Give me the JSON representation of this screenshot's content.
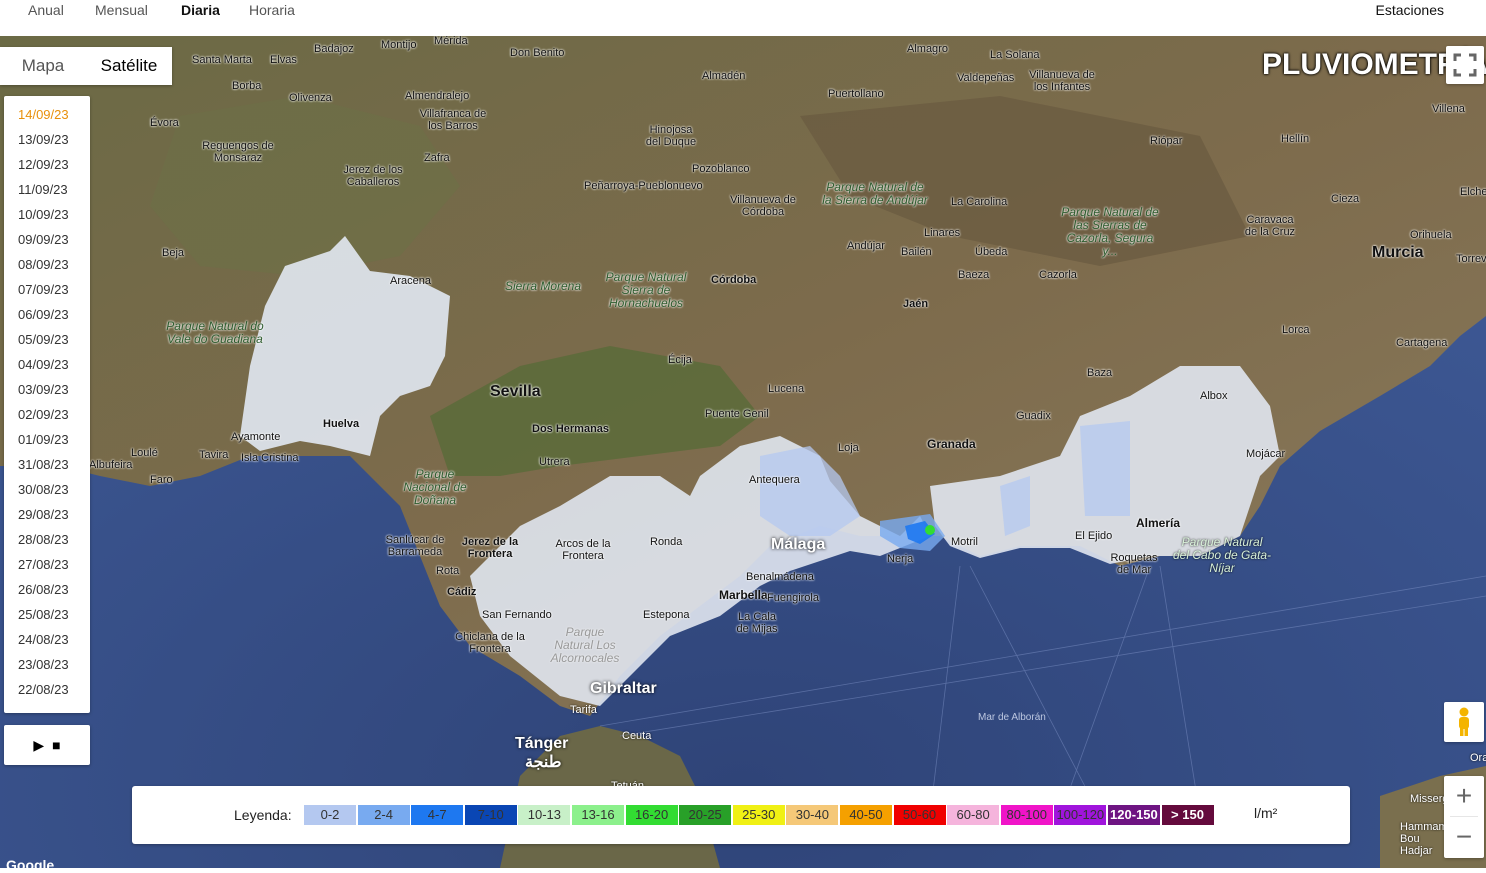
{
  "nav": {
    "tabs": [
      {
        "label": "Anual"
      },
      {
        "label": "Mensual"
      },
      {
        "label": "Diaria"
      },
      {
        "label": "Horaria"
      }
    ],
    "stations": "Estaciones"
  },
  "map_type": {
    "map": "Mapa",
    "satellite": "Satélite"
  },
  "title": "PLUVIOMETRÍA",
  "dates": [
    "14/09/23",
    "13/09/23",
    "12/09/23",
    "11/09/23",
    "10/09/23",
    "09/09/23",
    "08/09/23",
    "07/09/23",
    "06/09/23",
    "05/09/23",
    "04/09/23",
    "03/09/23",
    "02/09/23",
    "01/09/23",
    "31/08/23",
    "30/08/23",
    "29/08/23",
    "28/08/23",
    "27/08/23",
    "26/08/23",
    "25/08/23",
    "24/08/23",
    "23/08/23",
    "22/08/23"
  ],
  "selected_date": "14/09/23",
  "controls": {
    "play": "▶",
    "stop": "■"
  },
  "legend": {
    "label": "Leyenda:",
    "unit": "l/m²",
    "ranges": [
      {
        "label": "0-2",
        "color": "#b4c8f0"
      },
      {
        "label": "2-4",
        "color": "#78aaf0"
      },
      {
        "label": "4-7",
        "color": "#1e78f0"
      },
      {
        "label": "7-10",
        "color": "#0a46b4"
      },
      {
        "label": "10-13",
        "color": "#c8f0c8"
      },
      {
        "label": "13-16",
        "color": "#8cf08c"
      },
      {
        "label": "16-20",
        "color": "#32dc32"
      },
      {
        "label": "20-25",
        "color": "#28a028"
      },
      {
        "label": "25-30",
        "color": "#f0f014"
      },
      {
        "label": "30-40",
        "color": "#f5c878"
      },
      {
        "label": "40-50",
        "color": "#f5a000"
      },
      {
        "label": "50-60",
        "color": "#f00000"
      },
      {
        "label": "60-80",
        "color": "#f5b4dc"
      },
      {
        "label": "80-100",
        "color": "#f014c8"
      },
      {
        "label": "100-120",
        "color": "#a014dc"
      },
      {
        "label": "120-150",
        "color": "#6e1482"
      },
      {
        "label": "> 150",
        "color": "#640a3c"
      }
    ]
  },
  "places": [
    {
      "name": "Badajoz"
    },
    {
      "name": "Montijo"
    },
    {
      "name": "Mérida"
    },
    {
      "name": "Don Benito"
    },
    {
      "name": "Almagro"
    },
    {
      "name": "La Solana"
    },
    {
      "name": "Valdepeñas"
    },
    {
      "name": "Villanueva de los Infantes"
    },
    {
      "name": "Santa Marta"
    },
    {
      "name": "Elvas"
    },
    {
      "name": "Almendralejo"
    },
    {
      "name": "Almadén"
    },
    {
      "name": "Puertollano"
    },
    {
      "name": "Borba"
    },
    {
      "name": "Olivenza"
    },
    {
      "name": "Villafranca de los Barros"
    },
    {
      "name": "Évora"
    },
    {
      "name": "Hinojosa del Duque"
    },
    {
      "name": "Villena"
    },
    {
      "name": "Hellín"
    },
    {
      "name": "Riópar"
    },
    {
      "name": "Reguengos de Monsaraz"
    },
    {
      "name": "Zafra"
    },
    {
      "name": "Pozoblanco"
    },
    {
      "name": "Jerez de los Caballeros"
    },
    {
      "name": "Peñarroya-Pueblonuevo"
    },
    {
      "name": "Parque Natural de la Sierra de Andújar"
    },
    {
      "name": "Villanueva de Córdoba"
    },
    {
      "name": "La Carolina"
    },
    {
      "name": "Elche"
    },
    {
      "name": "Cieza"
    },
    {
      "name": "Parque Natural de las Sierras de Cazorla, Segura y..."
    },
    {
      "name": "Caravaca de la Cruz"
    },
    {
      "name": "Orihuela"
    },
    {
      "name": "Linares"
    },
    {
      "name": "Andújar"
    },
    {
      "name": "Bailén"
    },
    {
      "name": "Úbeda"
    },
    {
      "name": "Beja"
    },
    {
      "name": "Murcia"
    },
    {
      "name": "Torrevieja"
    },
    {
      "name": "Aracena"
    },
    {
      "name": "Baeza"
    },
    {
      "name": "Cazorla"
    },
    {
      "name": "Córdoba"
    },
    {
      "name": "Parque Natural Sierra de Hornachuelos"
    },
    {
      "name": "Sierra Morena"
    },
    {
      "name": "Jaén"
    },
    {
      "name": "Parque Natural do Vale do Guadiana"
    },
    {
      "name": "Lorca"
    },
    {
      "name": "Cartagena"
    },
    {
      "name": "Écija"
    },
    {
      "name": "Baza"
    },
    {
      "name": "Sevilla"
    },
    {
      "name": "Albox"
    },
    {
      "name": "Lucena"
    },
    {
      "name": "Puente Genil"
    },
    {
      "name": "Guadix"
    },
    {
      "name": "Ayamonte"
    },
    {
      "name": "Huelva"
    },
    {
      "name": "Dos Hermanas"
    },
    {
      "name": "Loja"
    },
    {
      "name": "Granada"
    },
    {
      "name": "Mojácar"
    },
    {
      "name": "Loulé"
    },
    {
      "name": "Tavira"
    },
    {
      "name": "Isla Cristina"
    },
    {
      "name": "Albufeira"
    },
    {
      "name": "Utrera"
    },
    {
      "name": "Faro"
    },
    {
      "name": "Antequera"
    },
    {
      "name": "Parque Nacional de Doñana"
    },
    {
      "name": "Arcos de la Frontera"
    },
    {
      "name": "Almería"
    },
    {
      "name": "El Ejido"
    },
    {
      "name": "Sanlúcar de Barrameda"
    },
    {
      "name": "Jerez de la Frontera"
    },
    {
      "name": "Ronda"
    },
    {
      "name": "Málaga"
    },
    {
      "name": "Motril"
    },
    {
      "name": "Parque Natural del Cabo de Gata-Níjar"
    },
    {
      "name": "Nerja"
    },
    {
      "name": "Roquetas de Mar"
    },
    {
      "name": "Rota"
    },
    {
      "name": "Benalmádena"
    },
    {
      "name": "Cádiz"
    },
    {
      "name": "Marbella"
    },
    {
      "name": "Fuengirola"
    },
    {
      "name": "San Fernando"
    },
    {
      "name": "Estepona"
    },
    {
      "name": "La Cala de Mijas"
    },
    {
      "name": "Chiclana de la Frontera"
    },
    {
      "name": "Parque Natural Los Alcornocales"
    },
    {
      "name": "Gibraltar"
    },
    {
      "name": "Tarifa"
    },
    {
      "name": "Mar de Alborán"
    },
    {
      "name": "Tánger"
    },
    {
      "name": "طنجة"
    },
    {
      "name": "Ceuta"
    },
    {
      "name": "Tetuán"
    },
    {
      "name": "Oran"
    },
    {
      "name": "Misserghin"
    },
    {
      "name": "Hammam Bou Hadjar"
    }
  ],
  "attribution": "Google"
}
